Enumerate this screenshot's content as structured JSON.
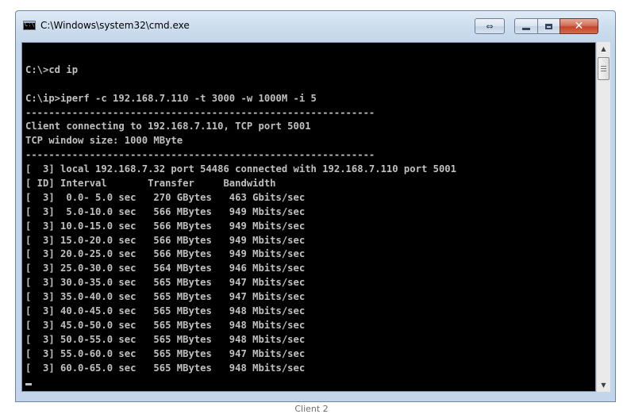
{
  "window": {
    "title": "C:\\Windows\\system32\\cmd.exe",
    "icon": "cmd-icon",
    "icon_text": "C:\\",
    "controls": {
      "switch_icon": "switch-icon",
      "minimize_icon": "minimize-icon",
      "maximize_icon": "maximize-icon",
      "close_icon": "close-icon",
      "close_glyph": "✕",
      "switch_glyph": "⇔"
    }
  },
  "console": {
    "background": "#000000",
    "foreground": "#c0c0c0",
    "lines": [
      "",
      "C:\\>cd ip",
      "",
      "C:\\ip>iperf -c 192.168.7.110 -t 3000 -w 1000M -i 5",
      "------------------------------------------------------------",
      "Client connecting to 192.168.7.110, TCP port 5001",
      "TCP window size: 1000 MByte",
      "------------------------------------------------------------",
      "[  3] local 192.168.7.32 port 54486 connected with 192.168.7.110 port 5001",
      "[ ID] Interval       Transfer     Bandwidth",
      "[  3]  0.0- 5.0 sec   270 GBytes   463 Gbits/sec",
      "[  3]  5.0-10.0 sec   566 MBytes   949 Mbits/sec",
      "[  3] 10.0-15.0 sec   566 MBytes   949 Mbits/sec",
      "[  3] 15.0-20.0 sec   566 MBytes   949 Mbits/sec",
      "[  3] 20.0-25.0 sec   566 MBytes   949 Mbits/sec",
      "[  3] 25.0-30.0 sec   564 MBytes   946 Mbits/sec",
      "[  3] 30.0-35.0 sec   565 MBytes   947 Mbits/sec",
      "[  3] 35.0-40.0 sec   565 MBytes   947 Mbits/sec",
      "[  3] 40.0-45.0 sec   565 MBytes   948 Mbits/sec",
      "[  3] 45.0-50.0 sec   565 MBytes   948 Mbits/sec",
      "[  3] 50.0-55.0 sec   565 MBytes   948 Mbits/sec",
      "[  3] 55.0-60.0 sec   565 MBytes   947 Mbits/sec",
      "[  3] 60.0-65.0 sec   565 MBytes   948 Mbits/sec",
      ""
    ]
  },
  "scrollbar": {
    "up_icon": "scroll-up-arrow-icon",
    "down_icon": "scroll-down-arrow-icon",
    "up_glyph": "▲",
    "down_glyph": "▼"
  },
  "caption": "Client 2"
}
